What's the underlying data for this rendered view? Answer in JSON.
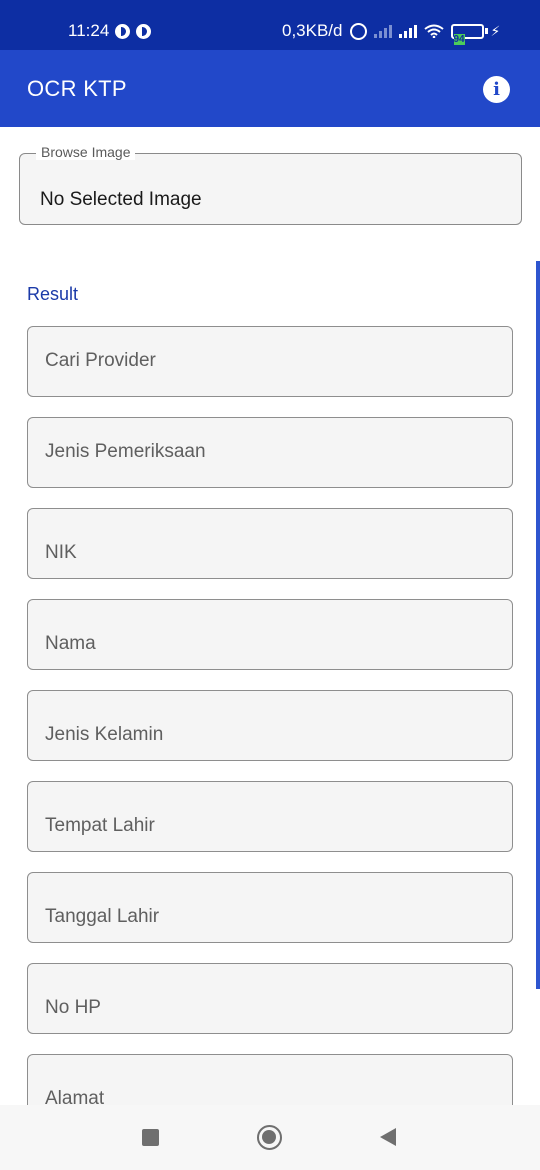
{
  "status_bar": {
    "time": "11:24",
    "network_speed": "0,3KB/d",
    "battery_level": "94"
  },
  "app_bar": {
    "title": "OCR KTP",
    "info_icon": "info-icon"
  },
  "browse": {
    "legend": "Browse Image",
    "value": "No Selected Image"
  },
  "result": {
    "label": "Result",
    "fields": [
      "Cari Provider",
      "Jenis Pemeriksaan",
      "NIK",
      "Nama",
      "Jenis Kelamin",
      "Tempat Lahir",
      "Tanggal Lahir",
      "No HP",
      "Alamat"
    ]
  },
  "nav_bar": {
    "icons": [
      "recents-icon",
      "home-icon",
      "back-icon"
    ]
  },
  "colors": {
    "status_bar": "#0d2ea3",
    "app_bar": "#2248c9",
    "accent": "#1b3aa8"
  }
}
